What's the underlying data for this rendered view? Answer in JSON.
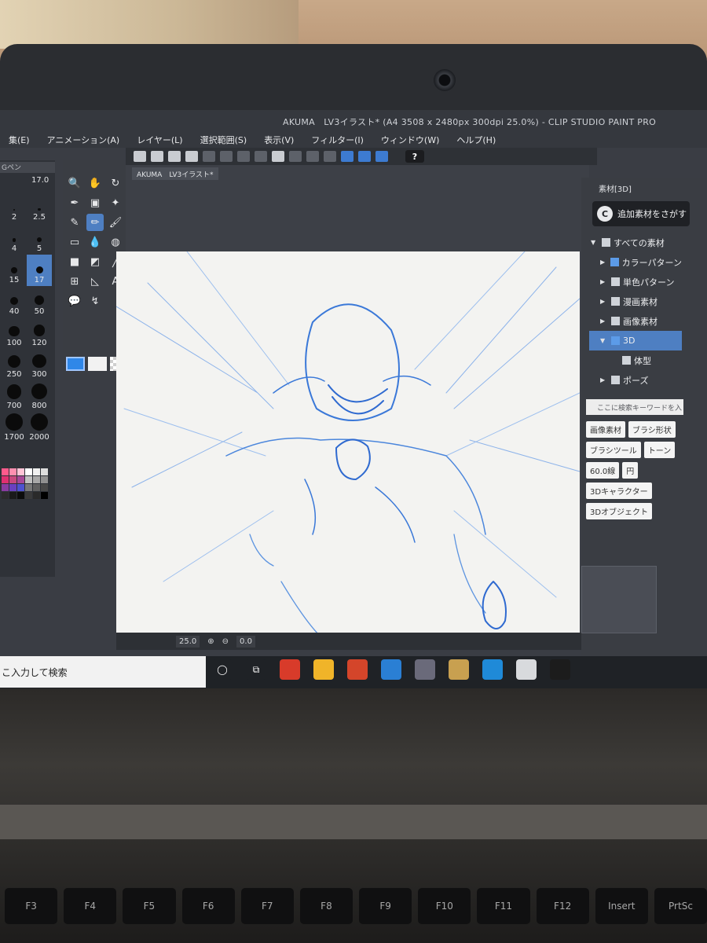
{
  "window": {
    "title": "AKUMA　LV3イラスト* (A4 3508 x 2480px 300dpi 25.0%) - CLIP STUDIO PAINT PRO"
  },
  "menu": [
    {
      "label": "集(E)"
    },
    {
      "label": "アニメーション(A)"
    },
    {
      "label": "レイヤー(L)"
    },
    {
      "label": "選択範囲(S)"
    },
    {
      "label": "表示(V)"
    },
    {
      "label": "フィルター(I)"
    },
    {
      "label": "ウィンドウ(W)"
    },
    {
      "label": "ヘルプ(H)"
    }
  ],
  "toolbar": {
    "help_label": "?"
  },
  "brush_panel": {
    "tab_label": "Gペン",
    "current_size": "17.0",
    "sizes": [
      "2",
      "2.5",
      "4",
      "5",
      "15",
      "17",
      "40",
      "50",
      "100",
      "120",
      "250",
      "300",
      "700",
      "800",
      "1700",
      "2000"
    ],
    "selected_size": "17"
  },
  "tools": {
    "items": [
      "zoom-icon",
      "hand-icon",
      "rotate-icon",
      "eyedropper-icon",
      "fill-icon",
      "sparkle-icon",
      "pen-icon",
      "pencil-icon",
      "brush-icon",
      "eraser-icon",
      "blend-icon",
      "airbrush-icon",
      "figure-icon",
      "gradient-icon",
      "line-icon",
      "frame-icon",
      "ruler-icon",
      "text-icon",
      "balloon-icon",
      "correct-icon"
    ],
    "text_label": "A"
  },
  "colors": {
    "main": "#2f87e8",
    "sub": "#f2f2f2",
    "palette": [
      "#ff5b8c",
      "#ff8fb0",
      "#ffc4d6",
      "#ffffff",
      "#f0f0f0",
      "#dddddd",
      "#e03070",
      "#c8487e",
      "#a84898",
      "#c0c0c0",
      "#a8a8a8",
      "#909090",
      "#8a3ca0",
      "#6a40c0",
      "#4e52d0",
      "#787878",
      "#606060",
      "#484848",
      "#2c2c2c",
      "#1a1a1a",
      "#0c0c0c",
      "#3a3a3a",
      "#2a2a2a",
      "#000000"
    ]
  },
  "document": {
    "tab_label": "AKUMA　LV3イラスト*",
    "zoom": "25.0",
    "angle": "0.0",
    "sketch_color": "#3a78d8"
  },
  "materials": {
    "tab_label": "素材[3D]",
    "find_button": "追加素材をさがす",
    "tree": [
      {
        "label": "すべての素材",
        "arrow": "▼",
        "icon": "folder"
      },
      {
        "label": "カラーパターン",
        "arrow": "▶",
        "icon": "blue"
      },
      {
        "label": "単色パターン",
        "arrow": "▶",
        "icon": "folder"
      },
      {
        "label": "漫画素材",
        "arrow": "▶",
        "icon": "folder"
      },
      {
        "label": "画像素材",
        "arrow": "▶",
        "icon": "folder"
      },
      {
        "label": "3D",
        "arrow": "▼",
        "icon": "blue",
        "selected": true
      },
      {
        "label": "体型",
        "arrow": "",
        "icon": "folder"
      },
      {
        "label": "ポーズ",
        "arrow": "▶",
        "icon": "folder"
      }
    ],
    "search_placeholder": "ここに検索キーワードを入",
    "tags": [
      "画像素材",
      "ブラシ形状",
      "ブラシツール",
      "トーン",
      "60.0線",
      "円",
      "3Dキャラクター",
      "3Dオブジェクト"
    ]
  },
  "taskbar": {
    "search_placeholder": "こ入力して検索",
    "apps": [
      "cortana-icon",
      "task-view-icon",
      "office-icon",
      "explorer-icon",
      "powerpoint-icon",
      "mail-icon",
      "disc-icon",
      "store-icon",
      "edge-icon",
      "clip-studio-icon",
      "clip-paint-icon"
    ]
  },
  "keyboard": {
    "keys": [
      "F3",
      "F4",
      "F5",
      "F6",
      "F7",
      "F8",
      "F9",
      "F10",
      "F11",
      "F12",
      "Insert",
      "PrtSc"
    ]
  }
}
